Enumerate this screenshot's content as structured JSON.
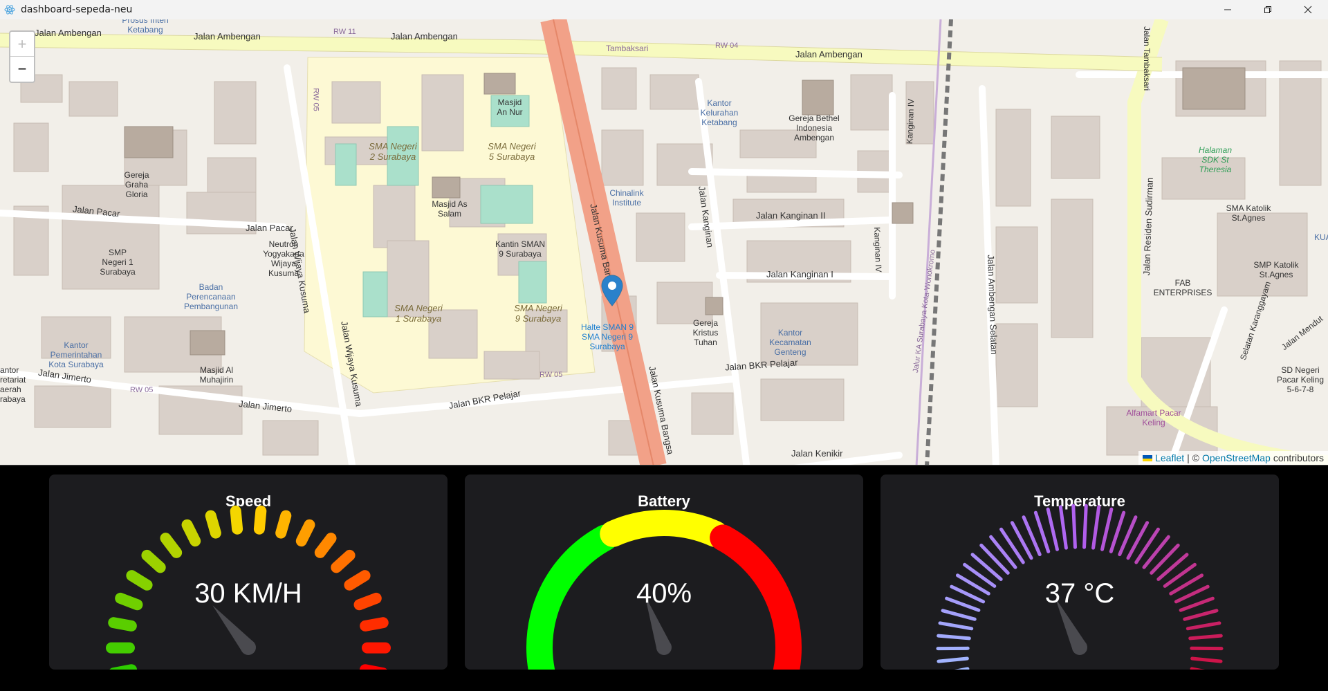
{
  "window": {
    "title": "dashboard-sepeda-neu",
    "minimize_icon": "minimize-icon",
    "maximize_icon": "restore-icon",
    "close_icon": "close-icon"
  },
  "map": {
    "zoom_in_label": "+",
    "zoom_out_label": "−",
    "attribution_leaflet": "Leaflet",
    "attribution_sep": "| ©",
    "attribution_osm": "OpenStreetMap",
    "attribution_contrib": "contributors",
    "labels": {
      "l1": "Jalan Ambengan",
      "l2": "Jalan Ambengan",
      "l3": "Jalan Ambengan",
      "l4": "Jalan Ambengan",
      "l5": "Jalan Pacar",
      "l6": "Jalan Pacar",
      "l7": "Jalan Wijaya Kusuma",
      "l8": "Jalan Wijaya Kusuma",
      "l9": "Jalan Kusuma Bangsa",
      "l10": "Jalan Kusuma Bangsa",
      "l11": "Jalan Kanginan",
      "l12": "Jalan Kanginan II",
      "l13": "Jalan Kanginan I",
      "l14": "Jalan BKR Pelajar",
      "l15": "Jalan BKR Pelajar",
      "l16": "Jalan Jimerto",
      "l17": "Jalan Jimerto",
      "l18": "Jalan Kenikir",
      "l19": "Jalan Residen Sudirman",
      "l20": "Jalan Ambengan Selatan",
      "l21": "SMA Negeri 2 Surabaya",
      "l22": "SMA Negeri 5 Surabaya",
      "l23": "SMA Negeri 1 Surabaya",
      "l24": "SMA Negeri 9 Surabaya",
      "l25": "Masjid An Nur",
      "l26": "Masjid As Salam",
      "l27": "Kantin SMAN 9 Surabaya",
      "l28": "Gereja Graha Gloria",
      "l29": "SMP Negeri 1 Surabaya",
      "l30": "Neutron Yogyakarta Wijaya Kusuma",
      "l31": "Badan Perencanaan Pembangunan",
      "l32": "Kantor Pemerintahan Kota Surabaya",
      "l33": "Masjid Al Muhajirin",
      "l34": "Chinalink Institute",
      "l35": "Kantor Kelurahan Ketabang",
      "l36": "Gereja Bethel Indonesia Ambengan",
      "l37": "Gereja Kristus Tuhan",
      "l38": "Kantor Kecamatan Genteng",
      "l39": "Halte SMAN 9 SMA Negeri 9 Surabaya",
      "l40": "Halaman SDK St Theresia",
      "l41": "SMA Katolik St.Agnes",
      "l42": "SMP Katolik St.Agnes",
      "l43": "FAB ENTERPRISES",
      "l44": "SD Negeri Pacar Keling 5-6-7-8",
      "l45": "Alfamart Pacar Keling",
      "l46": "RW 11",
      "l47": "RW 04",
      "l48": "RW 05",
      "l49": "RW 05",
      "l50": "RW 05",
      "l51": "Tambaksari",
      "l52": "Prosus Inten Ketabang",
      "l53": "Kanginan IV",
      "l54": "Kanginan IV",
      "l55": "Jalur KA Surabaya Kota-Wonokromo",
      "l56": "Jalan Tambaksari",
      "l57": "Selatan Karanggayam",
      "l58": "Jalan Mendut",
      "l59": "antor retariat aerah rabaya",
      "l60": "KUA"
    }
  },
  "gauges": {
    "speed": {
      "title": "Speed",
      "value": 30,
      "display": "30 KM/H",
      "max": 100,
      "colors": [
        "#2ecc00",
        "#ffd700",
        "#ff0000"
      ]
    },
    "battery": {
      "title": "Battery",
      "value": 40,
      "display": "40%",
      "colors": [
        "#00ff00",
        "#ffff00",
        "#ff0000"
      ]
    },
    "temperature": {
      "title": "Temperature",
      "value": 37,
      "display": "37 °C",
      "max": 100,
      "colors": [
        "#a0b8ff",
        "#b060f0",
        "#d01040"
      ]
    }
  }
}
